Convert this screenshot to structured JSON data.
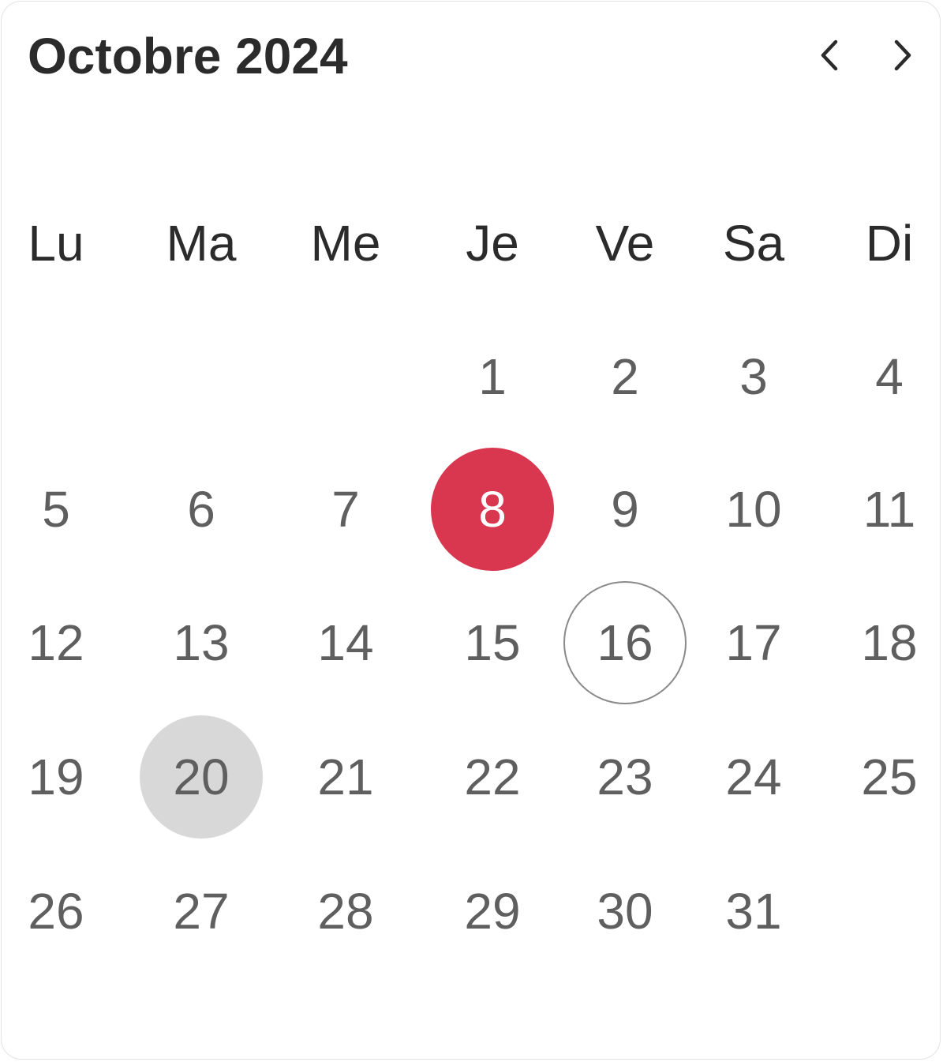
{
  "header": {
    "title": "Octobre 2024",
    "prev_icon": "chevron-left-icon",
    "next_icon": "chevron-right-icon"
  },
  "weekdays": [
    "Lu",
    "Ma",
    "Me",
    "Je",
    "Ve",
    "Sa",
    "Di"
  ],
  "weeks": [
    [
      "",
      "",
      "",
      "1",
      "2",
      "3",
      "4"
    ],
    [
      "5",
      "6",
      "7",
      "8",
      "9",
      "10",
      "11"
    ],
    [
      "12",
      "13",
      "14",
      "15",
      "16",
      "17",
      "18"
    ],
    [
      "19",
      "20",
      "21",
      "22",
      "23",
      "24",
      "25"
    ],
    [
      "26",
      "27",
      "28",
      "29",
      "30",
      "31",
      ""
    ]
  ],
  "states": {
    "selected_day": "8",
    "today_day": "16",
    "hover_day": "20"
  },
  "colors": {
    "selected": "#d9374f",
    "hover": "#d8d8d8",
    "today_ring": "#8a8a8a",
    "text": "#5f5f5f",
    "heading": "#2b2b2b"
  }
}
